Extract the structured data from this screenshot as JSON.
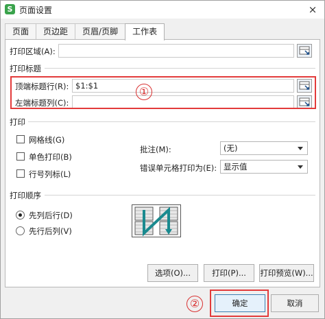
{
  "window": {
    "title": "页面设置",
    "app_icon_glyph": "S",
    "close_glyph": "×"
  },
  "tabs": [
    {
      "label": "页面",
      "active": false
    },
    {
      "label": "页边距",
      "active": false
    },
    {
      "label": "页眉/页脚",
      "active": false
    },
    {
      "label": "工作表",
      "active": true
    }
  ],
  "print_area": {
    "label": "打印区域(A):",
    "value": ""
  },
  "print_titles": {
    "section_label": "打印标题",
    "top_row": {
      "label": "顶端标题行(R):",
      "value": "$1:$1"
    },
    "left_column": {
      "label": "左端标题列(C):",
      "value": ""
    }
  },
  "print": {
    "section_label": "打印",
    "gridlines": {
      "label": "网格线(G)",
      "checked": false
    },
    "black_white": {
      "label": "单色打印(B)",
      "checked": false
    },
    "row_col_headers": {
      "label": "行号列标(L)",
      "checked": false
    },
    "comments": {
      "label": "批注(M):",
      "value": "(无)"
    },
    "cell_errors": {
      "label": "错误单元格打印为(E):",
      "value": "显示值"
    }
  },
  "page_order": {
    "section_label": "打印顺序",
    "down_then_over": {
      "label": "先列后行(D)",
      "selected": true
    },
    "over_then_down": {
      "label": "先行后列(V)",
      "selected": false
    }
  },
  "buttons": {
    "options": "选项(O)...",
    "print": "打印(P)...",
    "preview": "打印预览(W)...",
    "ok": "确定",
    "cancel": "取消"
  },
  "annotations": {
    "marker_1": "①",
    "marker_2": "②"
  },
  "colors": {
    "annotation_red": "#e23a3a",
    "app_green": "#3aa34c",
    "default_button_border": "#3c7fb1"
  }
}
